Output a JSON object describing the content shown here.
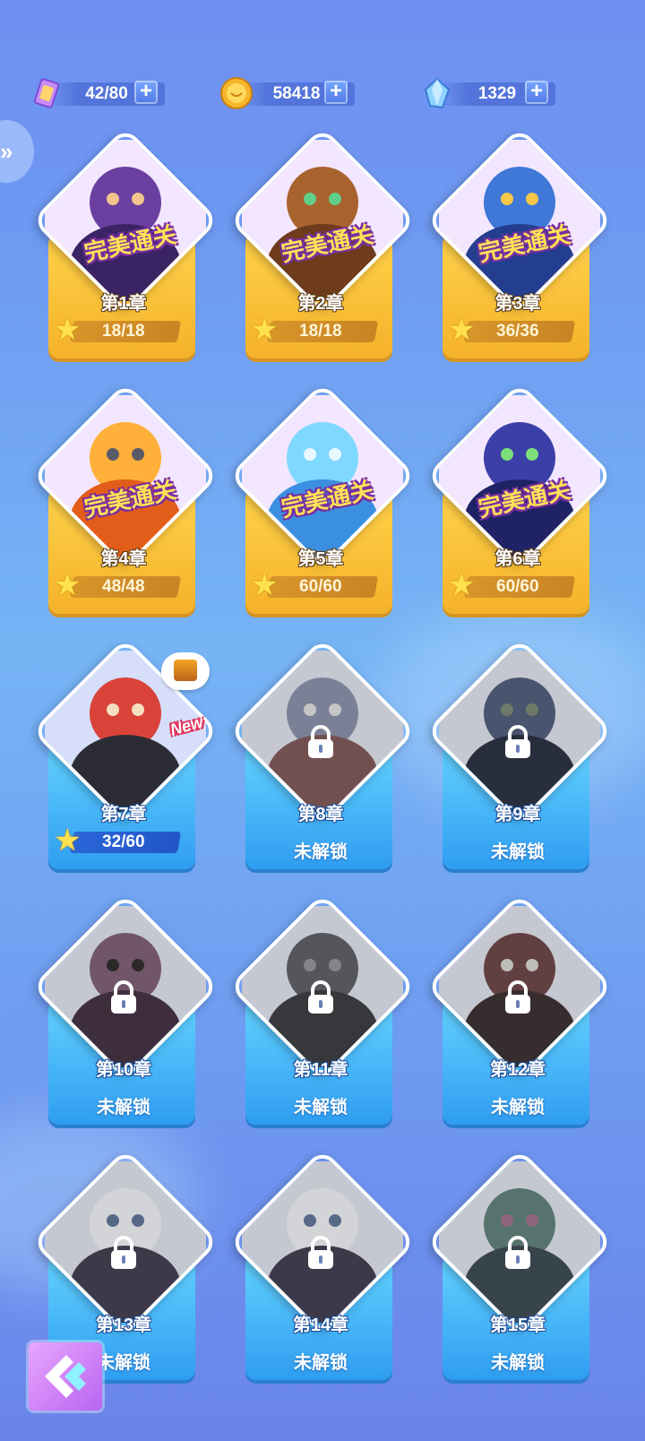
{
  "currencies": [
    {
      "icon": "ticket-icon",
      "value": "42/80"
    },
    {
      "icon": "gold-coin-icon",
      "value": "58418"
    },
    {
      "icon": "diamond-gem-icon",
      "value": "1329"
    }
  ],
  "perfect_label": "完美通关",
  "locked_label": "未解锁",
  "new_label": "New",
  "chapters": [
    {
      "name": "第1章",
      "stars": "18/18",
      "status": "perfect",
      "art": "demon-and-gentleman"
    },
    {
      "name": "第2章",
      "stars": "18/18",
      "status": "perfect",
      "art": "tree-ent"
    },
    {
      "name": "第3章",
      "stars": "36/36",
      "status": "perfect",
      "art": "robot-with-hat"
    },
    {
      "name": "第4章",
      "stars": "48/48",
      "status": "perfect",
      "art": "fire-pumpkin-knight"
    },
    {
      "name": "第5章",
      "stars": "60/60",
      "status": "perfect",
      "art": "ice-dragon"
    },
    {
      "name": "第6章",
      "stars": "60/60",
      "status": "perfect",
      "art": "diving-suit-monster"
    },
    {
      "name": "第7章",
      "stars": "32/60",
      "status": "current",
      "art": "bull-brute"
    },
    {
      "name": "第8章",
      "status": "locked",
      "art": "box-robot"
    },
    {
      "name": "第9章",
      "status": "locked",
      "art": "feathered-troll"
    },
    {
      "name": "第10章",
      "status": "locked",
      "art": "horned-ogre"
    },
    {
      "name": "第11章",
      "status": "locked",
      "art": "stone-golem"
    },
    {
      "name": "第12章",
      "status": "locked",
      "art": "chest-mimic"
    },
    {
      "name": "第13章",
      "status": "locked",
      "art": "snowman"
    },
    {
      "name": "第14章",
      "status": "locked",
      "art": "snowman"
    },
    {
      "name": "第15章",
      "status": "locked",
      "art": "witch"
    }
  ],
  "colors": {
    "gold_card": "#f4b22a",
    "blue_card": "#2f9df0",
    "background": "#6e9cf2",
    "perfect_text": "#ffe257",
    "perfect_outline": "#7a2fa0"
  }
}
